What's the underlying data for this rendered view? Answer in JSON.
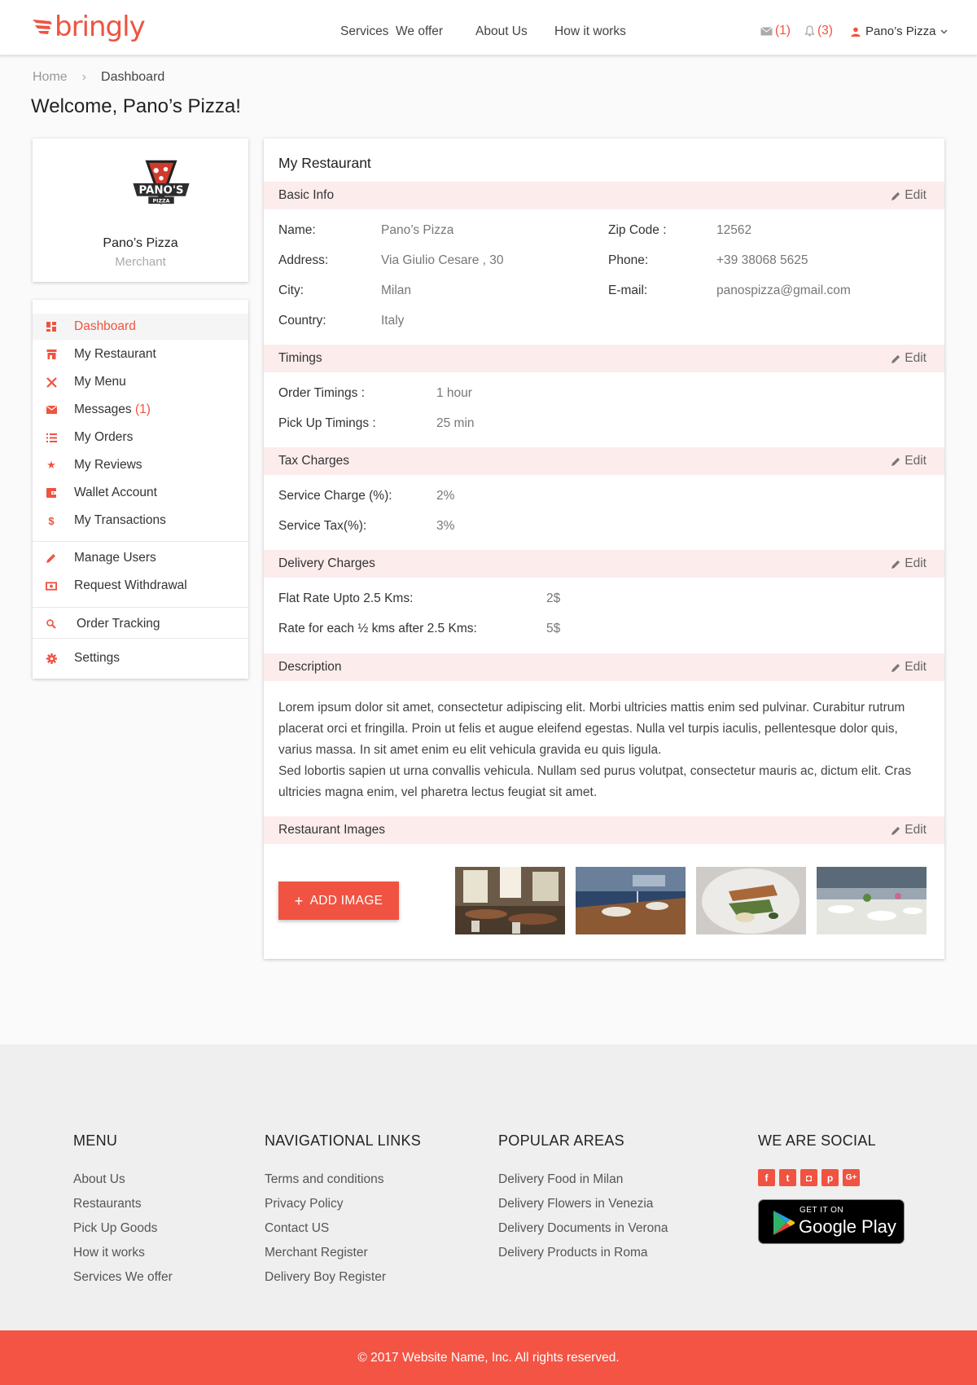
{
  "header": {
    "logo": "bringly",
    "nav": [
      "Services  We offer",
      "About Us",
      "How it works"
    ],
    "mail_count": "(1)",
    "notif_count": "(3)",
    "user_name": "Pano’s Pizza"
  },
  "breadcrumb": {
    "home": "Home",
    "current": "Dashboard"
  },
  "welcome": "Welcome, Pano’s Pizza!",
  "profile": {
    "logo_text": "PANO'S",
    "logo_sub": "PIZZA",
    "name": "Pano’s Pizza",
    "role": "Merchant"
  },
  "sidebar": {
    "items": [
      {
        "label": "Dashboard",
        "icon": "dashboard-icon"
      },
      {
        "label": "My Restaurant",
        "icon": "store-icon"
      },
      {
        "label": "My Menu",
        "icon": "utensils-icon"
      },
      {
        "label": "Messages",
        "badge": "(1)",
        "icon": "mail-icon"
      },
      {
        "label": "My Orders",
        "icon": "list-icon"
      },
      {
        "label": "My Reviews",
        "icon": "star-icon"
      },
      {
        "label": "Wallet Account",
        "icon": "wallet-icon"
      },
      {
        "label": "My Transactions",
        "icon": "dollar-icon"
      },
      {
        "label": "Manage Users",
        "icon": "pencil-icon"
      },
      {
        "label": "Request Withdrawal",
        "icon": "money-icon"
      },
      {
        "label": "Order Tracking",
        "icon": "search-icon"
      },
      {
        "label": "Settings",
        "icon": "gear-icon"
      }
    ]
  },
  "main": {
    "title": "My Restaurant",
    "edit_label": "Edit",
    "basic": {
      "title": "Basic Info",
      "name_label": "Name:",
      "name": "Pano’s Pizza",
      "address_label": "Address:",
      "address": "Via Giulio Cesare , 30",
      "city_label": "City:",
      "city": "Milan",
      "country_label": "Country:",
      "country": "Italy",
      "zip_label": "Zip Code :",
      "zip": "12562",
      "phone_label": "Phone:",
      "phone": "+39 38068 5625",
      "email_label": "E-mail:",
      "email": "panospizza@gmail.com"
    },
    "timings": {
      "title": "Timings",
      "order_label": "Order Timings :",
      "order": "1 hour",
      "pickup_label": "Pick Up Timings :",
      "pickup": "25 min"
    },
    "tax": {
      "title": "Tax Charges",
      "service_charge_label": "Service Charge (%):",
      "service_charge": "2%",
      "service_tax_label": "Service Tax(%):",
      "service_tax": "3%"
    },
    "delivery": {
      "title": "Delivery Charges",
      "flat_label": "Flat Rate Upto 2.5 Kms:",
      "flat": "2$",
      "rate_label": "Rate for each ½ kms after 2.5 Kms:",
      "rate": "5$"
    },
    "description": {
      "title": "Description",
      "p1": "Lorem ipsum dolor sit amet, consectetur adipiscing elit. Morbi ultricies mattis enim sed pulvinar. Curabitur rutrum placerat orci et fringilla. Proin ut felis et augue eleifend egestas. Nulla vel turpis iaculis, pellentesque dolor quis, varius massa. In sit amet enim eu elit vehicula gravida eu quis ligula.",
      "p2": "Sed lobortis sapien ut urna convallis vehicula. Nullam sed purus volutpat, consectetur mauris ac, dictum elit. Cras ultricies magna enim, vel pharetra lectus feugiat sit amet."
    },
    "images": {
      "title": "Restaurant Images",
      "add_label": "ADD IMAGE"
    }
  },
  "footer": {
    "menu": {
      "title": "MENU",
      "links": [
        "About Us",
        "Restaurants",
        "Pick Up Goods",
        "How it works",
        "Services We offer"
      ]
    },
    "nav": {
      "title": "NAVIGATIONAL LINKS",
      "links": [
        "Terms and conditions",
        "Privacy Policy",
        "Contact US",
        "Merchant Register",
        "Delivery Boy Register"
      ]
    },
    "areas": {
      "title": "POPULAR AREAS",
      "links": [
        "Delivery Food in Milan",
        "Delivery Flowers in Venezia",
        "Delivery Documents in Verona",
        "Delivery Products in Roma"
      ]
    },
    "social": {
      "title": "WE ARE SOCIAL",
      "icons": [
        "facebook-icon",
        "twitter-icon",
        "instagram-icon",
        "pinterest-icon",
        "google-plus-icon"
      ],
      "gplay_small": "GET IT ON",
      "gplay_big": "Google Play"
    },
    "copyright": "© 2017 Website Name, Inc. All rights reserved."
  },
  "colors": {
    "accent": "#f05341",
    "section_bg": "#fdecec",
    "footer_bg": "#efefef",
    "copyright_bg": "#f35444"
  }
}
